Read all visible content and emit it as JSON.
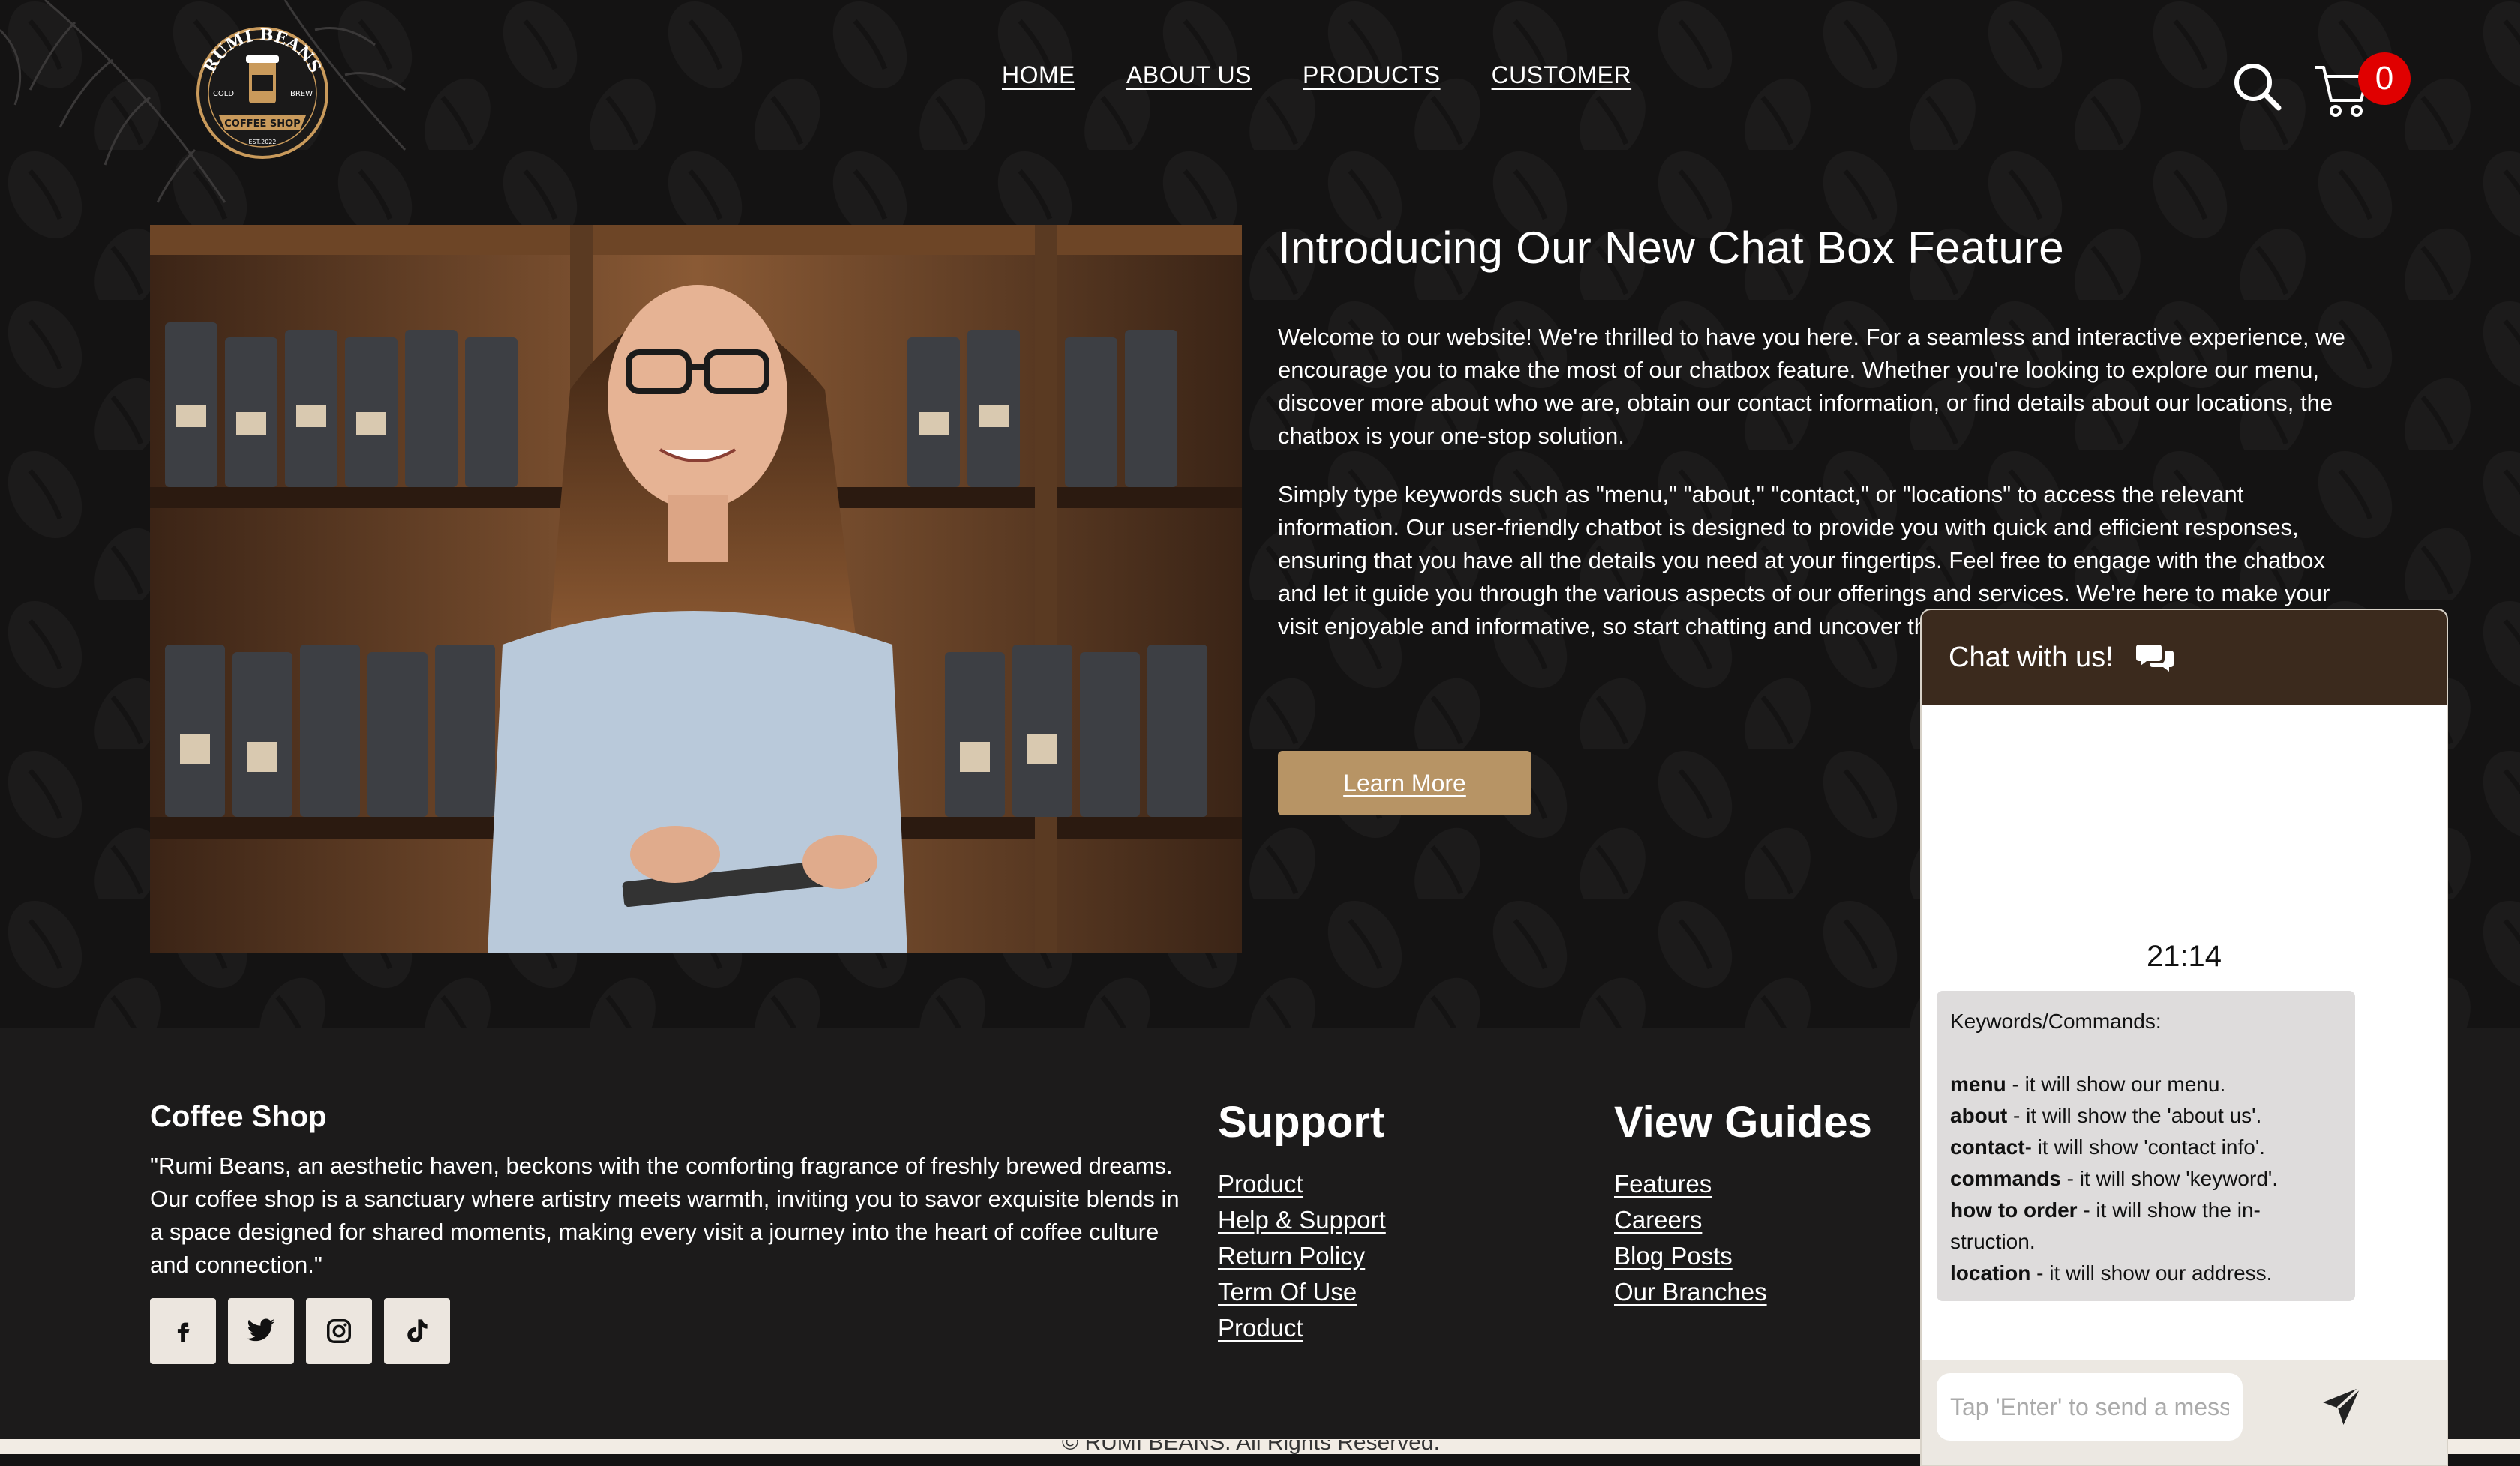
{
  "brand": {
    "logo_top": "RUMI BEANS",
    "logo_left": "COLD",
    "logo_right": "BREW",
    "logo_banner": "COFFEE SHOP",
    "logo_est": "EST.2022"
  },
  "nav": {
    "items": [
      {
        "label": "HOME"
      },
      {
        "label": "ABOUT US"
      },
      {
        "label": "PRODUCTS"
      },
      {
        "label": "CUSTOMER"
      }
    ]
  },
  "cart": {
    "count": "0"
  },
  "hero": {
    "title": "Introducing Our New Chat Box Feature",
    "paragraph1": "Welcome to our website! We're thrilled to have you here. For a seamless and interactive experience, we encourage you to make the most of our chatbox feature. Whether you're looking to explore our menu, discover more about who we are, obtain our contact information, or find details about our locations, the chatbox is your one-stop solution.",
    "paragraph2": "Simply type keywords such as \"menu,\" \"about,\" \"contact,\" or \"locations\" to access the relevant information. Our user-friendly chatbot is designed to provide you with quick and efficient responses, ensuring that you have all the details you need at your fingertips. Feel free to engage with the chatbox and let it guide you through the various aspects of our offerings and services. We're here to make your visit enjoyable and informative, so start chatting and uncover the wealth of information waiting for you!",
    "button_label": "Learn More"
  },
  "footer": {
    "title": "Coffee Shop",
    "text": "\"Rumi Beans, an aesthetic haven, beckons with the comforting fragrance of freshly brewed dreams. Our coffee shop is a sanctuary where artistry meets warmth, inviting you to savor exquisite blends in a space designed for shared moments, making every visit a journey into the heart of coffee culture and connection.\"",
    "socials": [
      "facebook-icon",
      "twitter-icon",
      "instagram-icon",
      "tiktok-icon"
    ],
    "support": {
      "title": "Support",
      "links": [
        "Product",
        "Help & Support",
        "Return Policy",
        "Term Of Use",
        "Product"
      ]
    },
    "guides": {
      "title": "View Guides",
      "links": [
        "Features",
        "Careers",
        "Blog Posts",
        "Our Branches"
      ]
    },
    "copyright": "© RUMI BEANS. All Rights Reserved."
  },
  "chat": {
    "title": "Chat with us!",
    "time": "21:14",
    "heading": "Keywords/Commands:",
    "commands": [
      {
        "key": "menu",
        "desc": " - it will show our menu."
      },
      {
        "key": "about",
        "desc": " - it will show the 'about us'."
      },
      {
        "key": "contact",
        "desc": "- it will show 'contact info'."
      },
      {
        "key": "commands",
        "desc": " - it will show 'keyword'."
      },
      {
        "key": "how to order",
        "desc": " - it will show the in-struction."
      },
      {
        "key": "location",
        "desc": " - it will show our address."
      }
    ],
    "input_placeholder": "Tap 'Enter' to send a message"
  },
  "colors": {
    "background": "#141313",
    "accent": "#b79465",
    "chat_header": "#3b2a1d",
    "badge": "#e00000"
  }
}
